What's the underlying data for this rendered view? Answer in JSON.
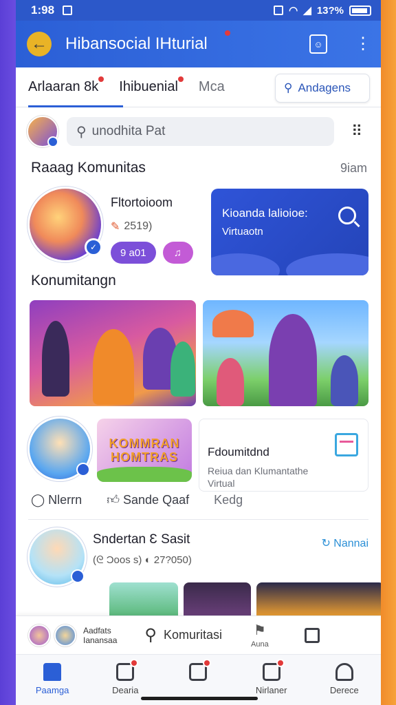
{
  "status": {
    "time": "1:98",
    "battery": "13?%"
  },
  "appbar": {
    "title": "Hibansocial IHturial"
  },
  "tabs": [
    {
      "label": "Arlaaran 8k",
      "active": true
    },
    {
      "label": "Ihibuenial",
      "active": false
    },
    {
      "label": "Mca",
      "active": false
    }
  ],
  "tab_search": {
    "label": "Andagens"
  },
  "search": {
    "placeholder": "unodhita Pat"
  },
  "section1": {
    "title": "Raaag Komunitas",
    "more": "9iam"
  },
  "featured": {
    "name": "Fltortoioom",
    "stat": "2519)",
    "btn1": "9 a01",
    "btn2": "♫",
    "card_title": "Kioanda lalioioe:",
    "card_sub": "Virtuaotn"
  },
  "section2": {
    "title": "Konumitangn"
  },
  "post": {
    "banner": "KOMMRAN HOMTRAS",
    "title": "Fdoumitdnd",
    "desc1": "Reiua dan Klumantathe",
    "desc2": "Virtual"
  },
  "actions": {
    "comment": "Nlerrn",
    "like": "Sande Qaaf",
    "share": "Kedg"
  },
  "userpost": {
    "name": "Sndertan Ɛ Sasit",
    "stats": "(ᘓ Ɔoos s)  ◐ 27?050)",
    "follow": "Nannai"
  },
  "shortcuts": {
    "label1": "Aadfats",
    "label2": "Ianansaa",
    "search": "Komuritasi",
    "place": "Auna"
  },
  "bottomnav": [
    {
      "label": "Paamga",
      "active": true,
      "badge": false
    },
    {
      "label": "Dearia",
      "active": false,
      "badge": true
    },
    {
      "label": "",
      "active": false,
      "badge": true
    },
    {
      "label": "Nirlaner",
      "active": false,
      "badge": true
    },
    {
      "label": "Derece",
      "active": false,
      "badge": false
    }
  ],
  "colors": {
    "primary": "#2b5fd6",
    "accent_purple": "#7c4fd9",
    "badge_red": "#e23a3a"
  }
}
